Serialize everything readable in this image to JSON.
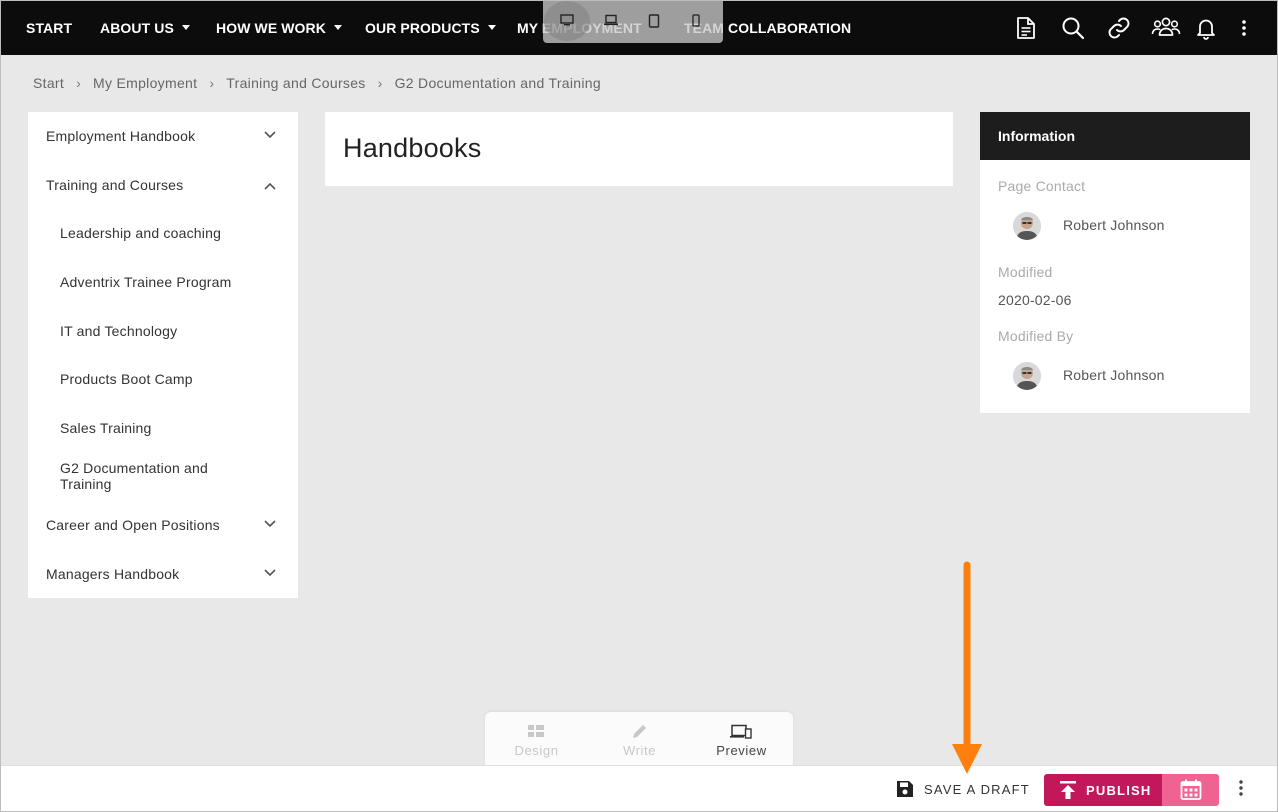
{
  "nav": {
    "items": [
      {
        "label": "START",
        "caret": false
      },
      {
        "label": "ABOUT US",
        "caret": true
      },
      {
        "label": "HOW WE WORK",
        "caret": true
      },
      {
        "label": "OUR PRODUCTS",
        "caret": true
      },
      {
        "label": "MY EMPLOYMENT",
        "caret": false
      },
      {
        "label": "TEAM COLLABORATION",
        "caret": false
      }
    ],
    "device_switch": [
      "desktop-icon",
      "laptop-icon",
      "tablet-icon",
      "phone-icon"
    ],
    "right_icons": [
      "document-icon",
      "search-icon",
      "link-icon",
      "people-icon",
      "bell-icon",
      "more-vertical-icon"
    ]
  },
  "breadcrumb": {
    "items": [
      "Start",
      "My Employment",
      "Training and Courses",
      "G2 Documentation and Training"
    ],
    "separator": "›"
  },
  "sidebar": {
    "items": [
      {
        "label": "Employment Handbook",
        "chevron": "down"
      },
      {
        "label": "Training and Courses",
        "chevron": "up"
      },
      {
        "label": "Leadership and coaching"
      },
      {
        "label": "Adventrix Trainee Program"
      },
      {
        "label": "IT and Technology"
      },
      {
        "label": "Products Boot Camp"
      },
      {
        "label": "Sales Training"
      },
      {
        "label": "G2 Documentation and Training"
      },
      {
        "label": "Career and Open Positions",
        "chevron": "down"
      },
      {
        "label": "Managers Handbook",
        "chevron": "down"
      }
    ]
  },
  "main": {
    "title": "Handbooks"
  },
  "info": {
    "header": "Information",
    "page_contact_label": "Page Contact",
    "page_contact_name": "Robert Johnson",
    "modified_label": "Modified",
    "modified_value": "2020-02-06",
    "modified_by_label": "Modified By",
    "modified_by_name": "Robert Johnson"
  },
  "modes": {
    "design": "Design",
    "write": "Write",
    "preview": "Preview",
    "active": "preview"
  },
  "bottom": {
    "save_draft": "SAVE A DRAFT",
    "publish": "PUBLISH"
  },
  "colors": {
    "nav_bg": "#0c0c0c",
    "publish": "#c2185b",
    "schedule": "#f06292",
    "annotation_arrow": "#ff7f0e"
  }
}
